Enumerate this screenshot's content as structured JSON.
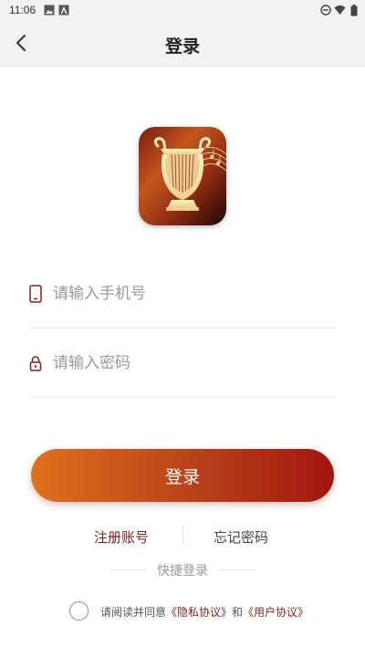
{
  "status_bar": {
    "time": "11:06"
  },
  "header": {
    "title": "登录"
  },
  "form": {
    "phone_placeholder": "请输入手机号",
    "password_placeholder": "请输入密码",
    "submit_label": "登录"
  },
  "links": {
    "register": "注册账号",
    "forgot": "忘记密码"
  },
  "quick_login": {
    "label": "快捷登录"
  },
  "agreement": {
    "prefix": "请阅读并同意",
    "privacy": "《隐私协议》",
    "and": "和",
    "user": "《用户协议》",
    "checked": false
  },
  "colors": {
    "accent": "#8a1f1b",
    "button_start": "#e0701e",
    "button_end": "#a3150f"
  }
}
